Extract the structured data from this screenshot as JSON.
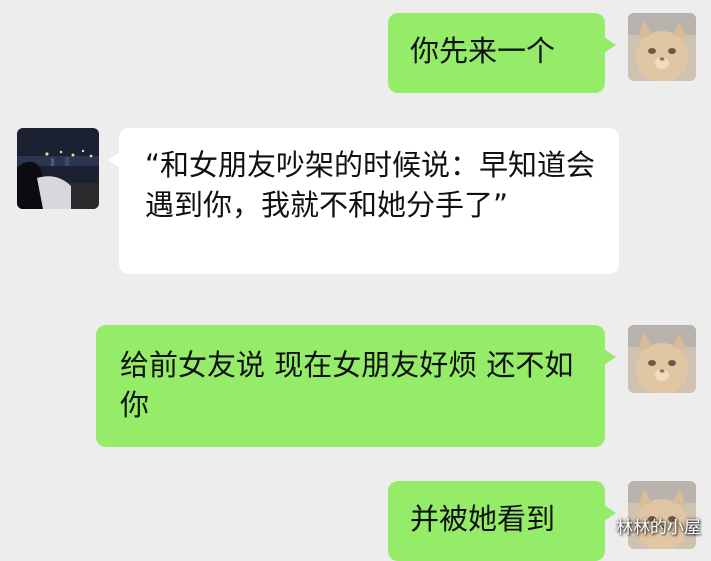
{
  "chat": {
    "messages": [
      {
        "side": "sent",
        "text": "你先来一个"
      },
      {
        "side": "received",
        "text": "“和女朋友吵架的时候说：早知道会遇到你，我就不和她分手了”"
      },
      {
        "side": "sent",
        "text": "给前女友说 现在女朋友好烦 还不如你"
      },
      {
        "side": "sent",
        "text": "并被她看到"
      }
    ]
  },
  "avatars": {
    "me": "cat-avatar",
    "other": "night-city-avatar"
  },
  "watermark": "林林的小屋",
  "colors": {
    "background": "#ededed",
    "sent_bubble": "#95ec69",
    "received_bubble": "#ffffff"
  }
}
